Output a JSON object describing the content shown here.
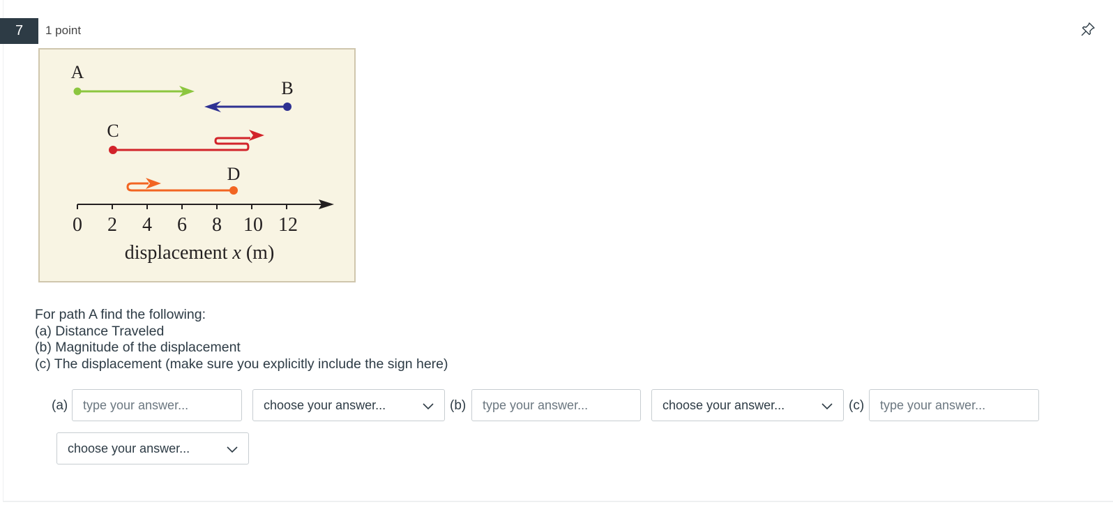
{
  "question": {
    "number": "7",
    "points": "1 point"
  },
  "icons": {
    "pin": "pin-icon",
    "dropdown": "chevron-down-icon"
  },
  "figure": {
    "labels": {
      "A": "A",
      "B": "B",
      "C": "C",
      "D": "D"
    },
    "axis_ticks": [
      "0",
      "2",
      "4",
      "6",
      "8",
      "10",
      "12"
    ],
    "axis_label_prefix": "displacement ",
    "axis_label_var": "x",
    "axis_label_suffix": " (m)",
    "colors": {
      "A": "#8cc63f",
      "B": "#2e3192",
      "C": "#d2232a",
      "D": "#f26522",
      "background": "#f8f4e3"
    }
  },
  "prompt": {
    "line1": "For path A find the following:",
    "line2": "(a) Distance Traveled",
    "line3": "(b) Magnitude of the displacement",
    "line4": "(c) The displacement (make sure you explicitly include the sign here)"
  },
  "answers": {
    "a_label": "(a)",
    "b_label": "(b)",
    "c_label": "(c)",
    "input_placeholder": "type your answer...",
    "select_value": "choose your answer..."
  }
}
